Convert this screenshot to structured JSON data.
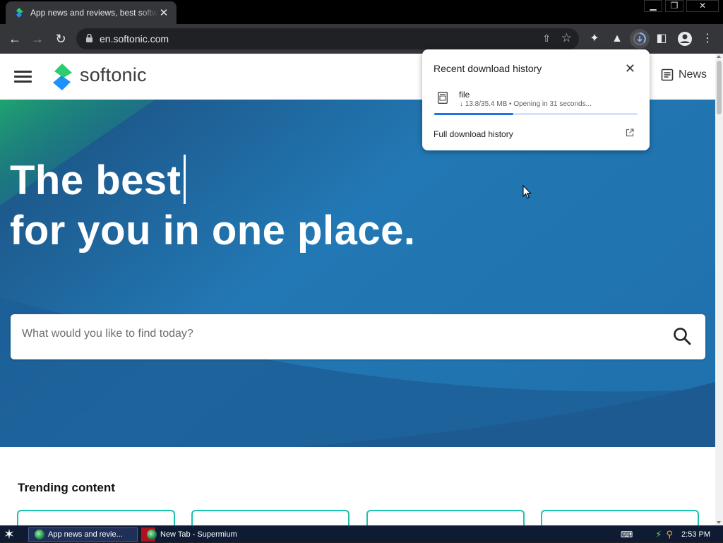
{
  "browser": {
    "tab_title": "App news and reviews, best software",
    "tab_close": "✕",
    "url": "en.softonic.com",
    "window_controls": [
      "▁",
      "❐",
      "✕"
    ]
  },
  "site": {
    "logo_text": "softonic",
    "news_label": "News"
  },
  "hero": {
    "line1": "The best",
    "line2": "for you in one place.",
    "search_placeholder": "What would you like to find today?"
  },
  "trending": {
    "title": "Trending content"
  },
  "download_bubble": {
    "title": "Recent download history",
    "close": "✕",
    "file_name": "file",
    "status": "↓ 13.8/35.4 MB • Opening in 31 seconds...",
    "progress": 0.39,
    "full_history": "Full download history"
  },
  "taskbar": {
    "tasks": [
      {
        "label": "App news and revie..."
      },
      {
        "label": "New Tab - Supermium"
      }
    ],
    "clock": "2:53 PM"
  },
  "colors": {
    "accent_teal": "#19c3b0",
    "hero_blue": "#1f6fa8",
    "progress_blue": "#1a73e8"
  }
}
